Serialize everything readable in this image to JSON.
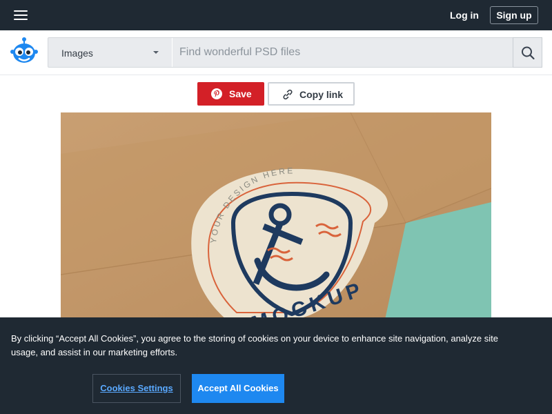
{
  "header": {
    "menu_icon": "hamburger-menu-icon",
    "login_label": "Log in",
    "signup_label": "Sign up"
  },
  "search": {
    "logo_icon": "robot-mascot-logo",
    "category": "Images",
    "placeholder": "Find wonderful PSD files",
    "value": "",
    "search_icon": "search-icon"
  },
  "actions": {
    "save_label": "Save",
    "save_icon": "pinterest-icon",
    "copy_label": "Copy link",
    "copy_icon": "link-icon"
  },
  "preview": {
    "sticker_arc_text": "YOUR DESIGN HERE",
    "sticker_mockup_text": "MOCKUP"
  },
  "cookie_banner": {
    "text": "By clicking “Accept All Cookies”, you agree to the storing of cookies on your device to enhance site navigation, analyze site usage, and assist in our marketing efforts.",
    "settings_label": "Cookies Settings",
    "accept_label": "Accept All Cookies"
  },
  "colors": {
    "topbar": "#1f2933",
    "save_red": "#d32027",
    "accept_blue": "#1e88f0",
    "logo_blue": "#1e88f0",
    "cardboard": "#c49a6c",
    "teal": "#7fc4b2"
  }
}
